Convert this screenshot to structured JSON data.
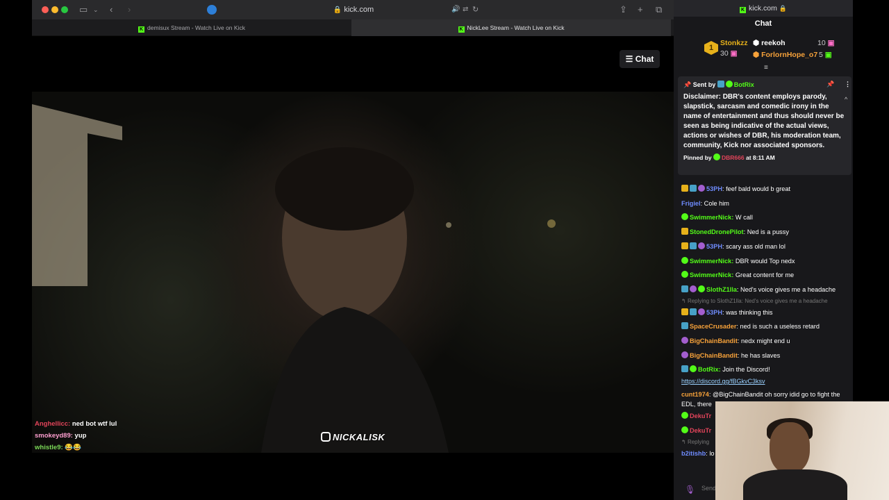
{
  "browser": {
    "url": "kick.com",
    "tabs": [
      {
        "label": "demisux Stream - Watch Live on Kick",
        "active": false
      },
      {
        "label": "NickLee Stream - Watch Live on Kick",
        "active": true
      }
    ]
  },
  "player": {
    "chat_toggle_label": "Chat",
    "watermark": "NICKALISK",
    "overlay_chat": [
      {
        "user": "Anghellicc:",
        "text": " ned bot wtf lul",
        "color": "#e2445a"
      },
      {
        "user": "smokeyd89:",
        "text": " yup",
        "color": "#ff9fd0"
      },
      {
        "user": "whistle9:",
        "text": " 😂😂",
        "color": "#7bd957"
      }
    ]
  },
  "chat": {
    "url": "kick.com",
    "title": "Chat",
    "top_gifters": [
      {
        "rank": "1",
        "name": "Stonkzz",
        "count": "30",
        "color": "#e7b11b"
      },
      {
        "name": "reekoh",
        "count": "10",
        "color": "#ffffff"
      },
      {
        "name": "ForlornHope_o7",
        "count": "5",
        "color": "#f7a23a"
      }
    ],
    "pinned": {
      "sent_by_label": "Sent by",
      "sent_by_user": "BotRix",
      "message": "Disclaimer: DBR's content employs parody, slapstick, sarcasm and comedic irony in the name of entertainment and thus should never be seen as being indicative of the actual views, actions or wishes of DBR, his moderation team, community, Kick nor associated sponsors.",
      "pinned_by_label": "Pinned by",
      "pinned_by_user": "DBR666",
      "pinned_at": "at 8:11 AM"
    },
    "messages": [
      {
        "user": "53PH",
        "text": ": feef bald would b great",
        "color": "#6f8cff"
      },
      {
        "user": "Frigiel",
        "text": ": Cole him",
        "color": "#6f8cff"
      },
      {
        "user": "SwimmerNick:",
        "text": " W call",
        "color": "#53fc18"
      },
      {
        "user": "StonedDronePilot",
        "text": ": Ned is a pussy",
        "color": "#53fc18"
      },
      {
        "user": "53PH",
        "text": ": scary ass old man lol",
        "color": "#6f8cff"
      },
      {
        "user": "SwimmerNick:",
        "text": " DBR would Top nedx",
        "color": "#53fc18"
      },
      {
        "user": "SwimmerNick:",
        "text": " Great content for me",
        "color": "#53fc18"
      },
      {
        "user": "SlothZ1lla",
        "text": ": Ned's voice gives me a headache",
        "color": "#53fc18"
      },
      {
        "reply": "Replying to SlothZ1lla: Ned's voice gives me a headache"
      },
      {
        "user": "53PH",
        "text": ": was thinking this",
        "color": "#6f8cff"
      },
      {
        "user": "SpaceCrusader",
        "text": ": ned is such a useless retard",
        "color": "#f7a23a"
      },
      {
        "user": "BigChainBandit",
        "text": ": nedx might end u",
        "color": "#f7a23a"
      },
      {
        "user": "BigChainBandit",
        "text": ": he has slaves",
        "color": "#f7a23a"
      },
      {
        "user": "BotRix:",
        "text": " Join the Discord!",
        "color": "#53fc18"
      },
      {
        "link": "https://discord.gg/fBGkvC3ksv"
      },
      {
        "user": "cunt1974",
        "text": ": @BigChainBandit oh sorry idid go to fight the",
        "color": "#f7a23a"
      },
      {
        "cont": "EDL, there"
      },
      {
        "user": "DekuTr",
        "text": "",
        "color": "#e2445a"
      },
      {
        "user": "DekuTr",
        "text": "",
        "color": "#e2445a"
      },
      {
        "reply": "Replying"
      },
      {
        "user": "b2itishb",
        "text": ": lo",
        "color": "#6f8cff"
      }
    ],
    "input_placeholder": "Send message"
  }
}
